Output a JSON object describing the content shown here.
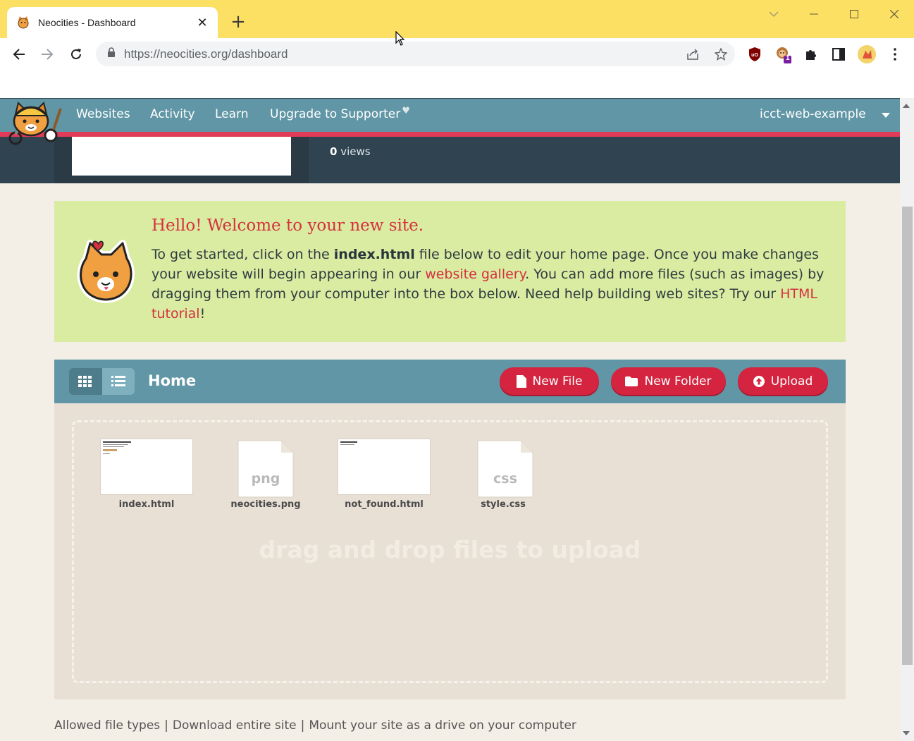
{
  "browser": {
    "tab_title": "Neocities - Dashboard",
    "tab_close": "✕",
    "new_tab": "+",
    "url": "https://neocities.org/dashboard",
    "extension_badge": "1"
  },
  "nav": {
    "items": [
      {
        "label": "Websites"
      },
      {
        "label": "Activity"
      },
      {
        "label": "Learn"
      },
      {
        "label": "Upgrade to Supporter"
      }
    ],
    "heart": "♥",
    "username": "icct-web-example"
  },
  "stats": {
    "views_count": "0",
    "views_label": " views"
  },
  "welcome": {
    "title": "Hello! Welcome to your new site.",
    "text_1": "To get started, click on the ",
    "text_bold": "index.html",
    "text_2": " file below to edit your home page. Once you make changes your website will begin appearing in our ",
    "link_gallery": "website gallery",
    "text_3": ". You can add more files (such as images) by dragging them from your computer into the box below. Need help building web sites? Try our ",
    "link_tutorial": "HTML tutorial",
    "text_4": "!"
  },
  "file_manager": {
    "title": "Home",
    "new_file": "New File",
    "new_folder": "New Folder",
    "upload": "Upload",
    "drop_text": "drag and drop files to upload",
    "files": [
      {
        "name": "index.html",
        "kind": "page"
      },
      {
        "name": "neocities.png",
        "kind": "doc",
        "ext": "png"
      },
      {
        "name": "not_found.html",
        "kind": "page"
      },
      {
        "name": "style.css",
        "kind": "doc",
        "ext": "css"
      }
    ]
  },
  "footer": {
    "allowed": "Allowed file types",
    "download": "Download entire site",
    "mount": "Mount your site as a drive on your computer",
    "separator": "|"
  },
  "colors": {
    "chrome_yellow": "#fbe064",
    "nav_teal": "#6096a5",
    "accent_red": "#d4243f",
    "welcome_green": "#d9eca1"
  }
}
